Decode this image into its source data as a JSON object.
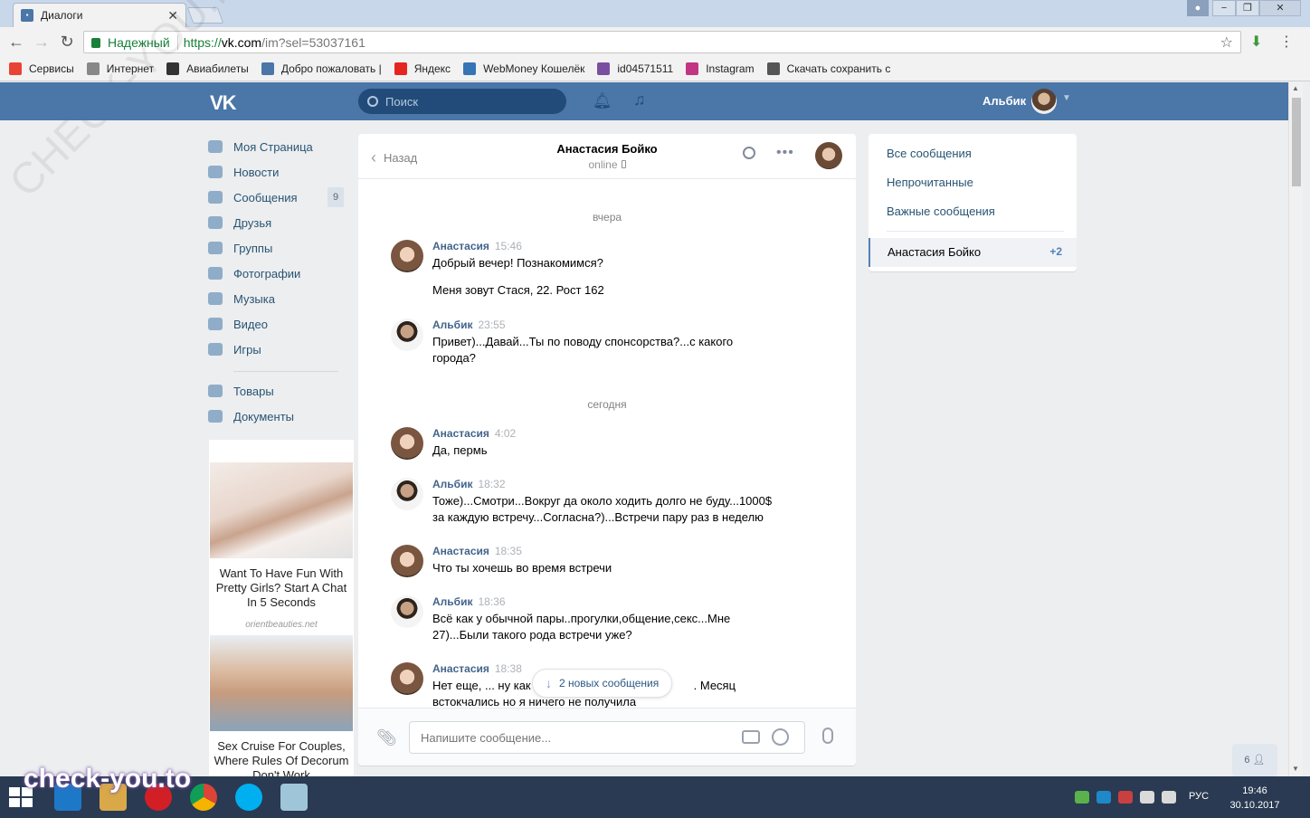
{
  "browser": {
    "tab_title": "Диалоги",
    "tab_close": "✕",
    "secure_label": "Надежный",
    "url_scheme": "https://",
    "url_host": "vk.com",
    "url_path": "/im?sel=53037161",
    "window_controls": [
      "−",
      "❐",
      "✕"
    ],
    "bookmarks": [
      {
        "label": "Сервисы",
        "icon": "apps-icon",
        "color": "#e94335"
      },
      {
        "label": "Интернет",
        "icon": "page-icon",
        "color": "#888888"
      },
      {
        "label": "Авиабилеты",
        "icon": "plane-icon",
        "color": "#333333"
      },
      {
        "label": "Добро пожаловать |",
        "icon": "vk-icon",
        "color": "#4a76a8"
      },
      {
        "label": "Яндекс",
        "icon": "yandex-icon",
        "color": "#e52620"
      },
      {
        "label": "WebMoney Кошелёк",
        "icon": "webmoney-icon",
        "color": "#3674b5"
      },
      {
        "label": "id04571511",
        "icon": "s-icon",
        "color": "#7b4fa0"
      },
      {
        "label": "Instagram",
        "icon": "instagram-icon",
        "color": "#c13584"
      },
      {
        "label": "Скачать сохранить с",
        "icon": "eye-icon",
        "color": "#555555"
      }
    ]
  },
  "header": {
    "search_placeholder": "Поиск",
    "user_name": "Альбик"
  },
  "nav": {
    "items": [
      {
        "label": "Моя Страница",
        "icon": "home-icon"
      },
      {
        "label": "Новости",
        "icon": "news-icon"
      },
      {
        "label": "Сообщения",
        "icon": "messages-icon",
        "badge": "9"
      },
      {
        "label": "Друзья",
        "icon": "friends-icon"
      },
      {
        "label": "Группы",
        "icon": "groups-icon"
      },
      {
        "label": "Фотографии",
        "icon": "camera-icon"
      },
      {
        "label": "Музыка",
        "icon": "music-icon"
      },
      {
        "label": "Видео",
        "icon": "video-icon"
      },
      {
        "label": "Игры",
        "icon": "games-icon"
      }
    ],
    "items2": [
      {
        "label": "Товары",
        "icon": "bag-icon"
      },
      {
        "label": "Документы",
        "icon": "document-icon"
      }
    ]
  },
  "ads": [
    {
      "text": "Want To Have Fun With Pretty Girls? Start A Chat In 5 Seconds",
      "domain": "orientbeauties.net"
    },
    {
      "text": "Sex Cruise For Couples, Where Rules Of Decorum Don't Work"
    }
  ],
  "chat": {
    "back_label": "Назад",
    "peer_name": "Анастасия Бойко",
    "peer_status": "online",
    "days": [
      "вчера",
      "сегодня"
    ],
    "messages": [
      {
        "author": "Анастасия",
        "time": "15:46",
        "text": "Добрый вечер! Познакомимся?",
        "side": "f"
      },
      {
        "author": "",
        "time": "",
        "text": "Меня зовут Стася, 22. Рост 162",
        "side": "f"
      },
      {
        "author": "Альбик",
        "time": "23:55",
        "text": "Привет)...Давай...Ты по поводу спонсорства?...с какого города?",
        "side": "m"
      },
      {
        "author": "Анастасия",
        "time": "4:02",
        "text": "Да, пермь",
        "side": "f"
      },
      {
        "author": "Альбик",
        "time": "18:32",
        "text": "Тоже)...Смотри...Вокруг да около ходить долго не буду...1000$ за каждую встречу...Согласна?)...Встречи пару раз в неделю",
        "side": "m"
      },
      {
        "author": "Анастасия",
        "time": "18:35",
        "text": "Что ты хочешь во время встречи",
        "side": "f"
      },
      {
        "author": "Альбик",
        "time": "18:36",
        "text": "Всё как у обычной пары..прогулки,общение,секс...Мне 27)...Были такого рода встречи уже?",
        "side": "m"
      },
      {
        "author": "Анастасия",
        "time": "18:38",
        "text_a": "Нет еще, ... ну как",
        "text_b": ". Месяц",
        "text_c": "встокчались но я ничего не получила",
        "side": "f"
      }
    ],
    "new_messages_label": "2 новых сообщения",
    "compose_placeholder": "Напишите сообщение..."
  },
  "right_menu": {
    "items": [
      "Все сообщения",
      "Непрочитанные",
      "Важные сообщения"
    ],
    "active_label": "Анастасия Бойко",
    "active_count": "+2"
  },
  "online_friends": "6",
  "watermarks": {
    "diagonal": "CHECK-YOU.ME",
    "logo": "check-you.to"
  },
  "taskbar": {
    "lang": "РУС",
    "time": "19:46",
    "date": "30.10.2017"
  }
}
